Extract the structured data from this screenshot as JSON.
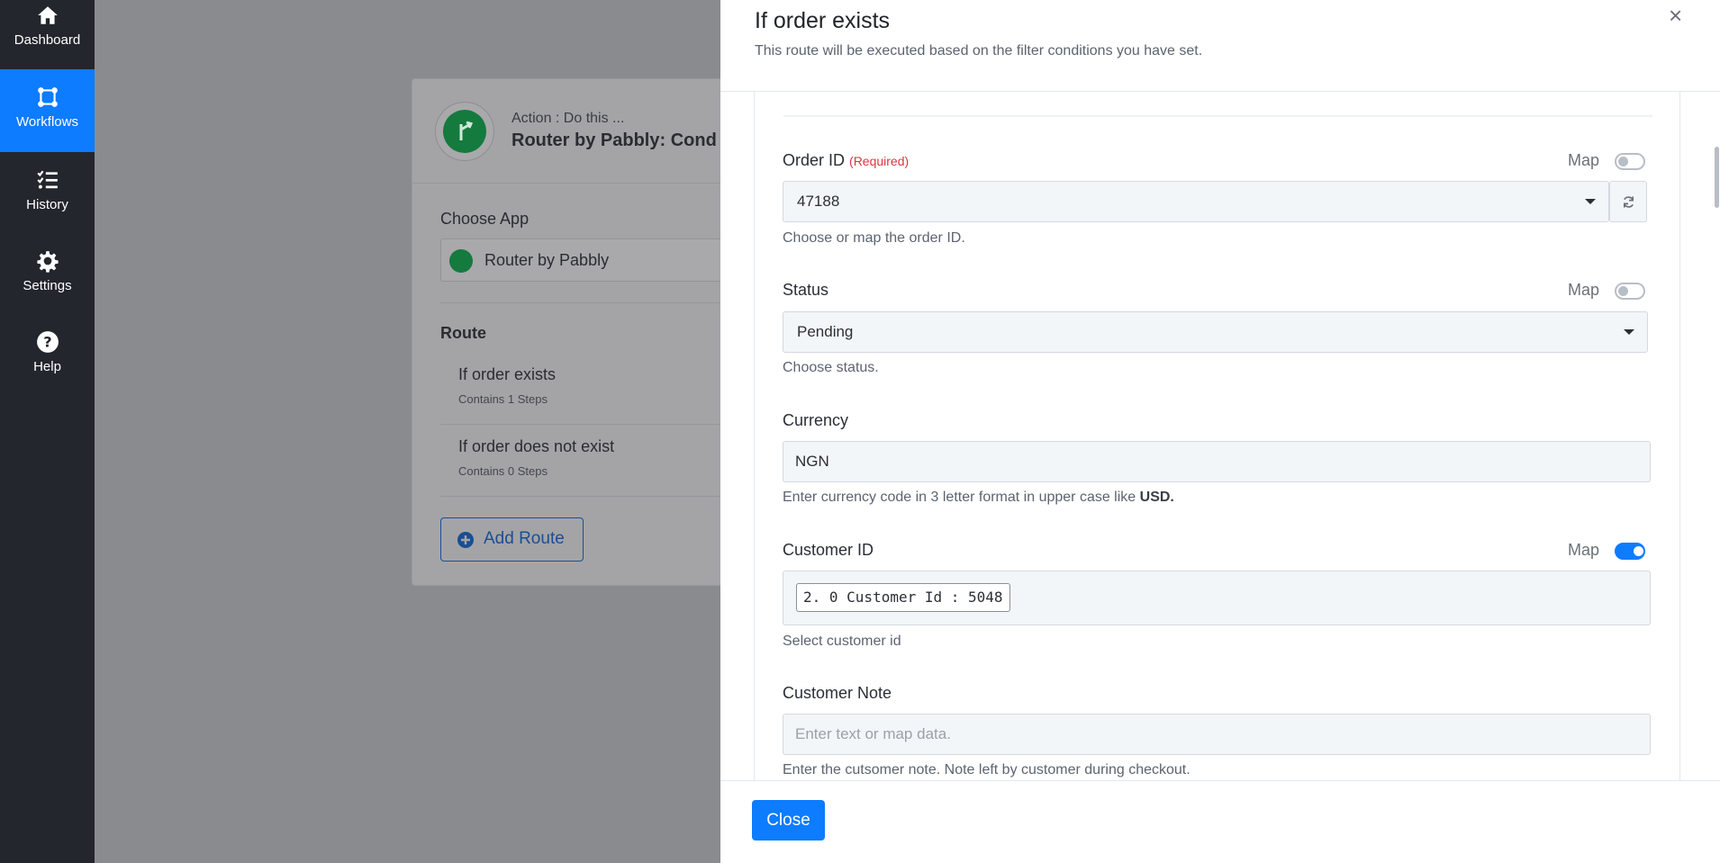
{
  "sidebar": {
    "items": [
      {
        "label": "Dashboard",
        "icon": "home-icon"
      },
      {
        "label": "Workflows",
        "icon": "workflows-icon",
        "active": true
      },
      {
        "label": "History",
        "icon": "history-list-icon"
      },
      {
        "label": "Settings",
        "icon": "gear-icon"
      },
      {
        "label": "Help",
        "icon": "question-circle-icon"
      }
    ]
  },
  "background": {
    "action_label": "Action : Do this ...",
    "action_title": "Router by Pabbly: Cond",
    "choose_app_label": "Choose App",
    "app_value": "Router by Pabbly",
    "route_heading": "Route",
    "routes": [
      {
        "name": "If order exists",
        "steps": "Contains 1 Steps"
      },
      {
        "name": "If order does not exist",
        "steps": "Contains 0 Steps"
      }
    ],
    "add_route_label": "Add Route"
  },
  "modal": {
    "title": "If order exists",
    "subtitle": "This route will be executed based on the filter conditions you have set.",
    "close_icon": "×",
    "map_label": "Map",
    "fields": {
      "order_id": {
        "label": "Order ID",
        "required": "(Required)",
        "value": "47188",
        "help": "Choose or map the order ID.",
        "map_on": false
      },
      "status": {
        "label": "Status",
        "value": "Pending",
        "help": "Choose status.",
        "map_on": false
      },
      "currency": {
        "label": "Currency",
        "value": "NGN",
        "help_prefix": "Enter currency code in 3 letter format in upper case like ",
        "help_bold": "USD."
      },
      "customer_id": {
        "label": "Customer ID",
        "chip": "2. 0 Customer Id : 5048",
        "help": "Select customer id",
        "map_on": true
      },
      "customer_note": {
        "label": "Customer Note",
        "placeholder": "Enter text or map data.",
        "help": "Enter the cutsomer note. Note left by customer during checkout."
      }
    },
    "close_button": "Close"
  },
  "colors": {
    "accent": "#0d7cff",
    "sidebar": "#23262d",
    "required": "#d9363e"
  }
}
